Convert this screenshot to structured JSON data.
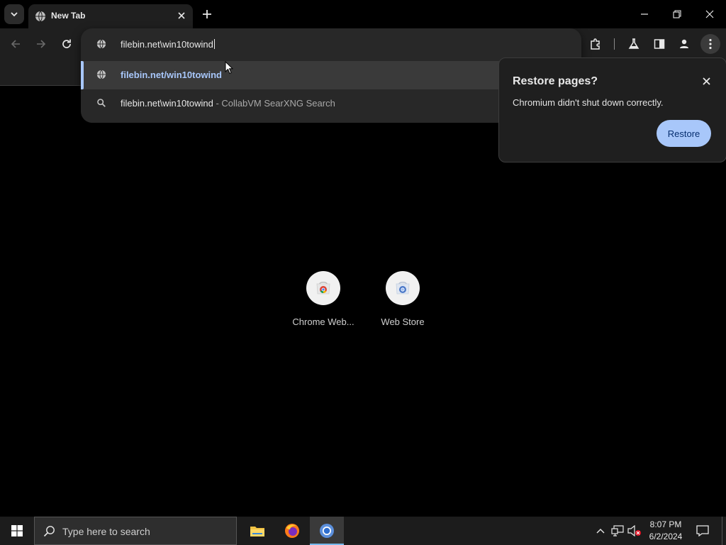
{
  "browser": {
    "tab": {
      "title": "New Tab"
    },
    "omnibox": {
      "input_text": "filebin.net\\win10towind",
      "suggestions": [
        {
          "text": "filebin.net/win10towind",
          "type": "url",
          "icon": "globe-icon"
        },
        {
          "text": "filebin.net\\win10towind",
          "separator": "-",
          "engine": "CollabVM SearXNG Search",
          "type": "search",
          "icon": "search-icon"
        }
      ]
    },
    "restore_dialog": {
      "title": "Restore pages?",
      "message": "Chromium didn't shut down correctly.",
      "button_label": "Restore"
    },
    "shortcuts": [
      {
        "label": "Chrome Web...",
        "icon": "chrome-web-store-icon"
      },
      {
        "label": "Web Store",
        "icon": "web-store-icon"
      }
    ]
  },
  "taskbar": {
    "search_placeholder": "Type here to search",
    "clock": {
      "time": "8:07 PM",
      "date": "6/2/2024"
    },
    "apps": [
      "file-explorer-icon",
      "firefox-icon",
      "chromium-icon"
    ]
  },
  "colors": {
    "accent": "#a8c7fa",
    "omnibox_bg": "#282828",
    "toolbar_bg": "#1f1f1f",
    "page_bg": "#000000",
    "taskbar_bg": "#1c1c1c"
  }
}
